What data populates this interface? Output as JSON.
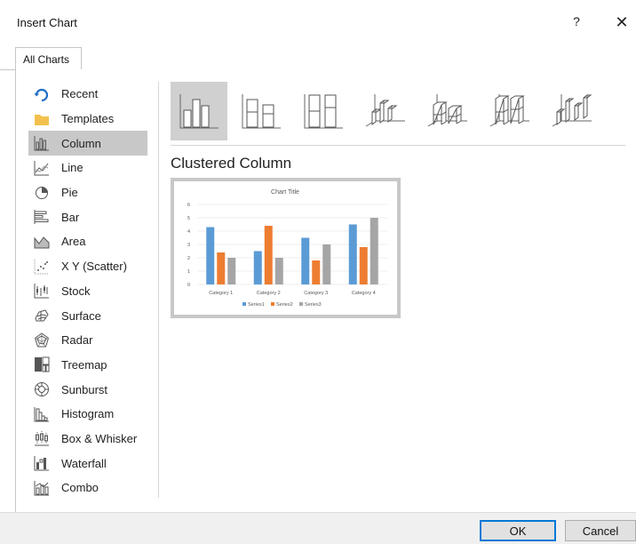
{
  "window": {
    "title": "Insert Chart",
    "help_label": "?",
    "close_label": "✕"
  },
  "tabs": [
    {
      "label": "All Charts"
    }
  ],
  "categories": [
    {
      "label": "Recent",
      "icon": "recent-icon"
    },
    {
      "label": "Templates",
      "icon": "folder-icon"
    },
    {
      "label": "Column",
      "icon": "column-chart-icon",
      "selected": true
    },
    {
      "label": "Line",
      "icon": "line-chart-icon"
    },
    {
      "label": "Pie",
      "icon": "pie-chart-icon"
    },
    {
      "label": "Bar",
      "icon": "bar-chart-icon"
    },
    {
      "label": "Area",
      "icon": "area-chart-icon"
    },
    {
      "label": "X Y (Scatter)",
      "icon": "scatter-chart-icon"
    },
    {
      "label": "Stock",
      "icon": "stock-chart-icon"
    },
    {
      "label": "Surface",
      "icon": "surface-chart-icon"
    },
    {
      "label": "Radar",
      "icon": "radar-chart-icon"
    },
    {
      "label": "Treemap",
      "icon": "treemap-chart-icon"
    },
    {
      "label": "Sunburst",
      "icon": "sunburst-chart-icon"
    },
    {
      "label": "Histogram",
      "icon": "histogram-chart-icon"
    },
    {
      "label": "Box & Whisker",
      "icon": "box-whisker-chart-icon"
    },
    {
      "label": "Waterfall",
      "icon": "waterfall-chart-icon"
    },
    {
      "label": "Combo",
      "icon": "combo-chart-icon"
    }
  ],
  "subtypes": [
    {
      "icon": "clustered-column-icon",
      "selected": true
    },
    {
      "icon": "stacked-column-icon"
    },
    {
      "icon": "100-stacked-column-icon"
    },
    {
      "icon": "3d-clustered-column-icon"
    },
    {
      "icon": "3d-stacked-column-icon"
    },
    {
      "icon": "3d-100-stacked-column-icon"
    },
    {
      "icon": "3d-column-icon"
    }
  ],
  "selected_subtype_title": "Clustered Column",
  "chart_data": {
    "type": "bar",
    "title": "Chart Title",
    "categories": [
      "Category 1",
      "Category 2",
      "Category 3",
      "Category 4"
    ],
    "series": [
      {
        "name": "Series1",
        "values": [
          4.3,
          2.5,
          3.5,
          4.5
        ],
        "color": "#5b9bd5"
      },
      {
        "name": "Series2",
        "values": [
          2.4,
          4.4,
          1.8,
          2.8
        ],
        "color": "#ed7d31"
      },
      {
        "name": "Series3",
        "values": [
          2,
          2,
          3,
          5
        ],
        "color": "#a5a5a5"
      }
    ],
    "ylim": [
      0,
      6
    ],
    "yticks": [
      "0",
      "1",
      "2",
      "3",
      "4",
      "5",
      "6"
    ],
    "grid": true,
    "legend": "bottom"
  },
  "buttons": {
    "ok_label": "OK",
    "cancel_label": "Cancel"
  },
  "colors": {
    "selection": "#c8c8c8",
    "default_button_border": "#0078d7",
    "icon_blue": "#1e6fc5",
    "folder_yellow": "#f2c14e"
  }
}
